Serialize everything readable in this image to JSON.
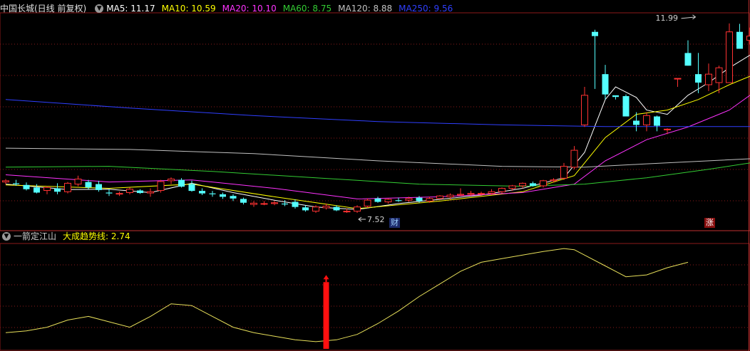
{
  "main_header": {
    "stock_label": "中国长城(日线 前复权)",
    "ma5_label": "MA5: 11.17",
    "ma10_label": "MA10: 10.59",
    "ma20_label": "MA20: 10.10",
    "ma60_label": "MA60: 8.75",
    "ma120_label": "MA120: 8.88",
    "ma250_label": "MA250: 9.56"
  },
  "sub_header": {
    "indicator_name": "一箭定江山",
    "line_label": "大成趋势线: 2.74"
  },
  "tags": {
    "cai": "财",
    "zhang": "涨"
  },
  "colors": {
    "ma5": "#ffffff",
    "ma10": "#ffff00",
    "ma20": "#ff33ff",
    "ma60": "#33cc33",
    "ma120": "#c0c0c0",
    "ma250": "#2f3fff",
    "up": "#ff3232",
    "down": "#54ffff",
    "grid": "#8b1a1a",
    "indicator": "#e8e05a",
    "signal": "#ff1010"
  },
  "chart_data": [
    {
      "type": "candlestick",
      "title": "中国长城(日线 前复权)",
      "ylim": [
        7.2,
        12.25
      ],
      "annotations": [
        {
          "label": "11.99",
          "type": "high",
          "x": 67
        },
        {
          "label": "7.52",
          "type": "low",
          "x": 34
        }
      ],
      "candles": [
        [
          8.25,
          8.32,
          8.2,
          8.28
        ],
        [
          8.22,
          8.3,
          8.16,
          8.2
        ],
        [
          8.18,
          8.24,
          8.05,
          8.08
        ],
        [
          8.12,
          8.2,
          7.98,
          8.0
        ],
        [
          8.05,
          8.15,
          7.96,
          8.12
        ],
        [
          8.1,
          8.22,
          7.96,
          8.02
        ],
        [
          8.02,
          8.25,
          7.98,
          8.22
        ],
        [
          8.2,
          8.4,
          8.15,
          8.32
        ],
        [
          8.25,
          8.3,
          8.08,
          8.12
        ],
        [
          8.2,
          8.28,
          8.02,
          8.06
        ],
        [
          8.0,
          8.08,
          7.92,
          7.98
        ],
        [
          7.98,
          8.02,
          7.92,
          7.98
        ],
        [
          8.0,
          8.12,
          7.96,
          8.08
        ],
        [
          8.05,
          8.08,
          7.97,
          7.99
        ],
        [
          7.99,
          8.1,
          7.9,
          8.02
        ],
        [
          8.05,
          8.3,
          8.0,
          8.26
        ],
        [
          8.28,
          8.36,
          8.2,
          8.32
        ],
        [
          8.3,
          8.34,
          8.12,
          8.14
        ],
        [
          8.2,
          8.28,
          8.02,
          8.04
        ],
        [
          8.04,
          8.1,
          7.94,
          7.98
        ],
        [
          7.98,
          8.04,
          7.9,
          7.96
        ],
        [
          7.96,
          8.0,
          7.85,
          7.9
        ],
        [
          7.92,
          7.96,
          7.8,
          7.86
        ],
        [
          7.85,
          7.88,
          7.72,
          7.76
        ],
        [
          7.72,
          7.8,
          7.66,
          7.75
        ],
        [
          7.74,
          7.8,
          7.7,
          7.74
        ],
        [
          7.74,
          7.8,
          7.7,
          7.76
        ],
        [
          7.74,
          7.82,
          7.68,
          7.72
        ],
        [
          7.78,
          7.84,
          7.62,
          7.66
        ],
        [
          7.65,
          7.7,
          7.55,
          7.58
        ],
        [
          7.56,
          7.7,
          7.52,
          7.66
        ],
        [
          7.64,
          7.74,
          7.6,
          7.68
        ],
        [
          7.66,
          7.7,
          7.56,
          7.58
        ],
        [
          7.56,
          7.62,
          7.52,
          7.56
        ],
        [
          7.56,
          7.7,
          7.52,
          7.66
        ],
        [
          7.68,
          7.86,
          7.64,
          7.82
        ],
        [
          7.86,
          7.9,
          7.76,
          7.78
        ],
        [
          7.78,
          7.86,
          7.74,
          7.84
        ],
        [
          7.82,
          7.88,
          7.78,
          7.8
        ],
        [
          7.82,
          7.9,
          7.78,
          7.86
        ],
        [
          7.88,
          7.92,
          7.76,
          7.8
        ],
        [
          7.8,
          7.9,
          7.76,
          7.86
        ],
        [
          7.86,
          7.94,
          7.84,
          7.92
        ],
        [
          7.9,
          7.98,
          7.84,
          7.94
        ],
        [
          7.94,
          8.1,
          7.92,
          7.96
        ],
        [
          7.96,
          8.04,
          7.92,
          7.98
        ],
        [
          7.98,
          8.02,
          7.92,
          7.98
        ],
        [
          7.98,
          8.08,
          7.94,
          8.02
        ],
        [
          8.02,
          8.12,
          7.98,
          8.1
        ],
        [
          8.1,
          8.18,
          8.04,
          8.16
        ],
        [
          8.16,
          8.24,
          8.1,
          8.22
        ],
        [
          8.22,
          8.26,
          8.14,
          8.16
        ],
        [
          8.16,
          8.3,
          8.12,
          8.28
        ],
        [
          8.28,
          8.34,
          8.24,
          8.3
        ],
        [
          8.34,
          8.7,
          8.3,
          8.62
        ],
        [
          8.6,
          9.1,
          8.55,
          9.0
        ],
        [
          9.6,
          10.5,
          9.55,
          10.3
        ],
        [
          11.8,
          11.85,
          10.45,
          11.7
        ],
        [
          10.8,
          11.02,
          10.2,
          10.32
        ],
        [
          10.3,
          10.28,
          10.2,
          10.26
        ],
        [
          10.28,
          10.32,
          9.8,
          9.8
        ],
        [
          9.7,
          9.9,
          9.45,
          9.6
        ],
        [
          9.6,
          9.9,
          9.45,
          9.82
        ],
        [
          9.8,
          9.82,
          9.45,
          9.58
        ],
        [
          9.5,
          9.52,
          9.38,
          9.5
        ],
        [
          10.7,
          10.7,
          10.5,
          10.7
        ],
        [
          11.3,
          11.6,
          11.0,
          11.0
        ],
        [
          10.8,
          11.3,
          10.35,
          10.6
        ],
        [
          10.55,
          11.05,
          10.4,
          10.8
        ],
        [
          10.6,
          11.0,
          10.35,
          10.95
        ],
        [
          10.6,
          12.0,
          10.6,
          11.8
        ],
        [
          11.8,
          11.99,
          11.4,
          11.4
        ],
        [
          11.6,
          11.9,
          11.5,
          11.7
        ]
      ],
      "ma_series": [
        {
          "name": "MA5",
          "color": "#ffffff",
          "points": [
            [
              0,
              8.2
            ],
            [
              6,
              8.07
            ],
            [
              10,
              8.08
            ],
            [
              14,
              8.0
            ],
            [
              18,
              8.22
            ],
            [
              22,
              8.0
            ],
            [
              26,
              7.82
            ],
            [
              30,
              7.66
            ],
            [
              34,
              7.6
            ],
            [
              38,
              7.74
            ],
            [
              42,
              7.84
            ],
            [
              46,
              7.94
            ],
            [
              50,
              8.1
            ],
            [
              54,
              8.35
            ],
            [
              56,
              8.95
            ],
            [
              58,
              10.2
            ],
            [
              59,
              10.5
            ],
            [
              61,
              10.25
            ],
            [
              62,
              9.95
            ],
            [
              64,
              9.85
            ],
            [
              66,
              10.3
            ],
            [
              68,
              10.6
            ],
            [
              70,
              10.95
            ],
            [
              72,
              11.25
            ]
          ]
        },
        {
          "name": "MA10",
          "color": "#ffff00",
          "points": [
            [
              0,
              8.18
            ],
            [
              10,
              8.1
            ],
            [
              18,
              8.2
            ],
            [
              26,
              7.9
            ],
            [
              34,
              7.62
            ],
            [
              42,
              7.8
            ],
            [
              50,
              8.02
            ],
            [
              55,
              8.4
            ],
            [
              58,
              9.3
            ],
            [
              61,
              9.85
            ],
            [
              64,
              9.95
            ],
            [
              67,
              10.2
            ],
            [
              70,
              10.55
            ],
            [
              72,
              10.75
            ]
          ]
        },
        {
          "name": "MA20",
          "color": "#ff33ff",
          "points": [
            [
              0,
              8.42
            ],
            [
              10,
              8.25
            ],
            [
              18,
              8.3
            ],
            [
              26,
              8.1
            ],
            [
              34,
              7.85
            ],
            [
              42,
              7.9
            ],
            [
              50,
              8.0
            ],
            [
              55,
              8.2
            ],
            [
              58,
              8.75
            ],
            [
              62,
              9.25
            ],
            [
              66,
              9.55
            ],
            [
              70,
              9.95
            ],
            [
              72,
              10.3
            ]
          ]
        },
        {
          "name": "MA60",
          "color": "#33cc33",
          "points": [
            [
              0,
              8.6
            ],
            [
              10,
              8.62
            ],
            [
              20,
              8.5
            ],
            [
              30,
              8.35
            ],
            [
              40,
              8.2
            ],
            [
              50,
              8.15
            ],
            [
              56,
              8.2
            ],
            [
              62,
              8.35
            ],
            [
              68,
              8.55
            ],
            [
              72,
              8.7
            ]
          ]
        },
        {
          "name": "MA120",
          "color": "#c0c0c0",
          "points": [
            [
              0,
              9.05
            ],
            [
              12,
              9.02
            ],
            [
              24,
              8.92
            ],
            [
              36,
              8.75
            ],
            [
              48,
              8.62
            ],
            [
              56,
              8.6
            ],
            [
              62,
              8.68
            ],
            [
              68,
              8.75
            ],
            [
              72,
              8.8
            ]
          ]
        },
        {
          "name": "MA250",
          "color": "#2f3fff",
          "points": [
            [
              0,
              10.2
            ],
            [
              12,
              10.0
            ],
            [
              24,
              9.82
            ],
            [
              36,
              9.68
            ],
            [
              48,
              9.6
            ],
            [
              58,
              9.56
            ],
            [
              72,
              9.56
            ]
          ]
        }
      ]
    },
    {
      "type": "line",
      "title": "一箭定江山",
      "ylim": [
        0.8,
        3.8
      ],
      "series": [
        {
          "name": "大成趋势线",
          "color": "#e8e05a",
          "points": [
            [
              0,
              1.25
            ],
            [
              2,
              1.3
            ],
            [
              4,
              1.4
            ],
            [
              6,
              1.6
            ],
            [
              8,
              1.7
            ],
            [
              10,
              1.55
            ],
            [
              12,
              1.4
            ],
            [
              14,
              1.7
            ],
            [
              16,
              2.05
            ],
            [
              18,
              2.0
            ],
            [
              20,
              1.7
            ],
            [
              22,
              1.4
            ],
            [
              24,
              1.25
            ],
            [
              26,
              1.15
            ],
            [
              28,
              1.05
            ],
            [
              30,
              1.0
            ],
            [
              32,
              1.05
            ],
            [
              34,
              1.2
            ],
            [
              36,
              1.5
            ],
            [
              38,
              1.85
            ],
            [
              40,
              2.25
            ],
            [
              42,
              2.6
            ],
            [
              44,
              2.95
            ],
            [
              46,
              3.2
            ],
            [
              48,
              3.3
            ],
            [
              50,
              3.4
            ],
            [
              52,
              3.5
            ],
            [
              54,
              3.58
            ],
            [
              55,
              3.55
            ],
            [
              56,
              3.4
            ],
            [
              58,
              3.1
            ],
            [
              60,
              2.8
            ],
            [
              62,
              2.85
            ],
            [
              64,
              3.05
            ],
            [
              66,
              3.2
            ]
          ]
        }
      ],
      "signal_bars": [
        {
          "x": 31,
          "from": 0.8,
          "to": 2.65
        }
      ]
    }
  ]
}
